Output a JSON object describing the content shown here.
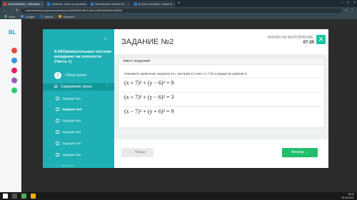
{
  "browser": {
    "tabs": [
      {
        "label": "OnlineMektep - Bilimland",
        "active": true
      },
      {
        "label": "Укажите, какое из уравнен",
        "active": false
      },
      {
        "label": "Финальные Знания по",
        "active": false
      },
      {
        "label": "8 класс алгебра. Укажите",
        "active": false
      }
    ],
    "new_tab": "+",
    "url": "onlinemektep.org/schedule/lesson/32803a0b-8fc9-4a1d-9f8d-653e6e2b3808",
    "bookmarks": [
      "Игры",
      "Google",
      "Mail.ru",
      "Новости"
    ]
  },
  "sidebar": {
    "course_title": "8.4AПримоугольные система координат на плоскости (Часть 1)",
    "overview_label": "Обзор урока",
    "contents_label": "Содержание урока",
    "tasks": [
      {
        "label": "Задание №1",
        "active": false
      },
      {
        "label": "Задание №2",
        "active": true
      },
      {
        "label": "Задание №3",
        "active": false
      },
      {
        "label": "Задание №4",
        "active": false
      },
      {
        "label": "Задание №5",
        "active": false
      },
      {
        "label": "Задание №6",
        "active": false
      }
    ],
    "resources_label": "Обо урок"
  },
  "main": {
    "task_title": "ЗАДАНИЕ №2",
    "timer_label": "ВРЕМЯ НА ВЫПОЛНЕНИЕ:",
    "timer_value": "07:20",
    "card_header": "ТЕКСТ ЗАДАНИЯ",
    "question": "Напишите уравнение окружности с центром в точке А (-7;6) и радиусом равным 3.",
    "options": [
      "(x + 7)² + (y − 6)² = 9",
      "(x + 7)² + (y − 6)² = 3",
      "(x − 7)² + (y + 6)² = 9"
    ],
    "back_label": "Назад",
    "next_label": "Вперед"
  },
  "taskbar": {
    "time": "16:02",
    "date": "09.05.2021"
  },
  "colors": {
    "sidebar": "#1eb0b4",
    "sidebar_active": "#11979b",
    "next_button": "#1fbf6a",
    "timer_icon": "#19c4a4"
  }
}
